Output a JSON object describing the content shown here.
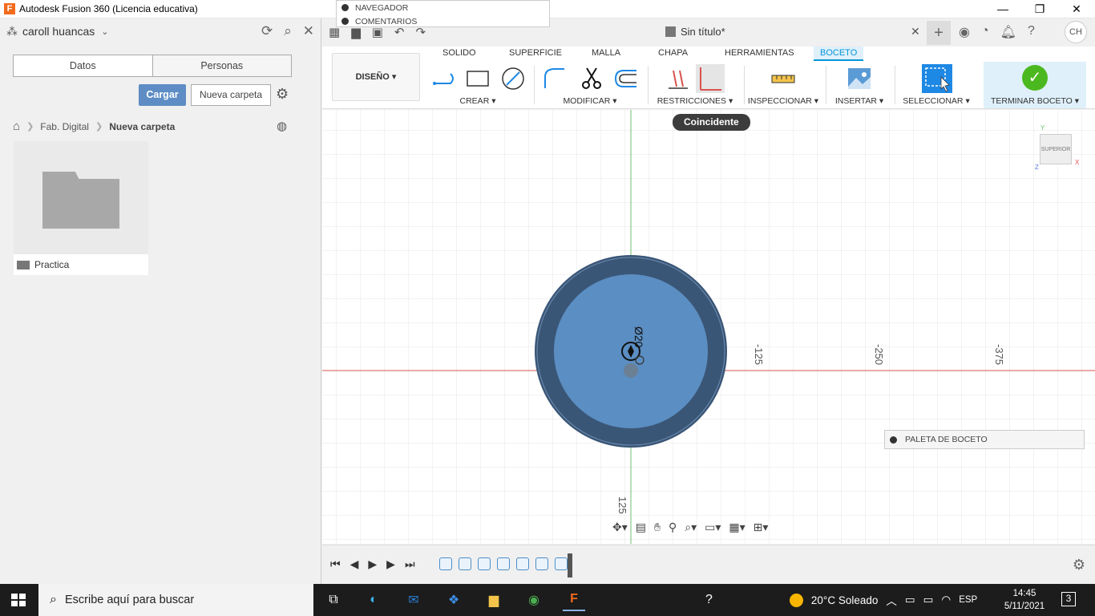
{
  "window": {
    "title": "Autodesk Fusion 360 (Licencia educativa)",
    "minimize": "—",
    "maximize": "❐",
    "close": "✕"
  },
  "browser_strip": {
    "items": [
      "NAVEGADOR",
      "COMENTARIOS"
    ]
  },
  "datapanel": {
    "user_name": "caroll huancas",
    "tabs": [
      "Datos",
      "Personas"
    ],
    "upload_label": "Cargar",
    "new_folder_label": "Nueva carpeta",
    "breadcrumb": [
      "Fab. Digital",
      "Nueva carpeta"
    ],
    "folders": [
      {
        "name": "Practica"
      }
    ]
  },
  "document": {
    "title": "Sin título*",
    "user_initials": "CH"
  },
  "toolbar": {
    "design_label": "DISEÑO",
    "tabs": [
      "SOLIDO",
      "SUPERFICIE",
      "MALLA",
      "CHAPA",
      "HERRAMIENTAS",
      "BOCETO"
    ],
    "active_tab": "BOCETO",
    "groups": [
      "CREAR",
      "MODIFICAR",
      "RESTRICCIONES",
      "INSPECCIONAR",
      "INSERTAR",
      "SELECCIONAR",
      "TERMINAR BOCETO"
    ]
  },
  "canvas": {
    "tooltip": "Coincidente",
    "dimension_label": "Ø20",
    "axis_labels": [
      "-125",
      "-250",
      "-375",
      "125"
    ],
    "viewcube_label": "SUPERIOR",
    "axis_letters": {
      "x": "X",
      "y": "Y",
      "z": "Z"
    },
    "palette_label": "PALETA DE BOCETO",
    "colors": {
      "circle_fill": "#5b8ec2",
      "circle_ring": "#3a5677",
      "grid": "#e6e6e6",
      "x_axis": "#d9534f",
      "y_axis": "#6cc16c"
    }
  },
  "taskbar": {
    "search_placeholder": "Escribe aquí para buscar",
    "weather": "20°C  Soleado",
    "language": "ESP",
    "time": "14:45",
    "date": "5/11/2021",
    "notifications": "3"
  }
}
